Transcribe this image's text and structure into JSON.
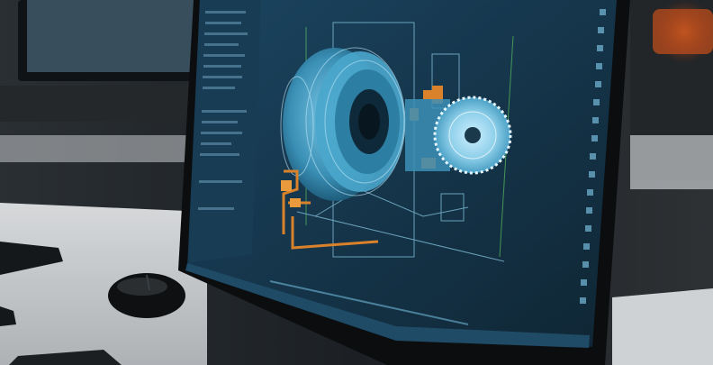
{
  "scene": {
    "description_colors": {
      "desk": "#c9ccce",
      "screen_bg": "#163448",
      "model_cyan": "#4fb3d4",
      "pipe_orange": "#d9822b",
      "bezel": "#0c0e10"
    }
  }
}
